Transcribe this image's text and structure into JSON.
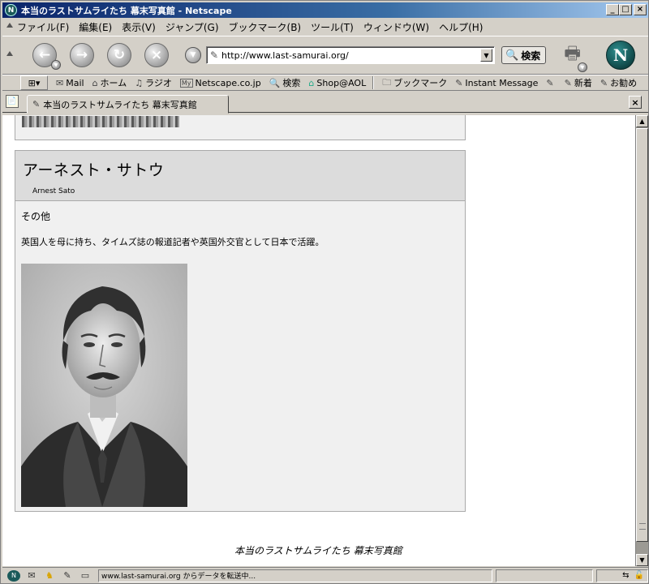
{
  "window": {
    "title": "本当のラストサムライたち 幕末写真館 - Netscape",
    "app_icon": "N",
    "minimize_glyph": "_",
    "maximize_glyph": "□",
    "close_glyph": "×"
  },
  "menubar": {
    "items": [
      "ファイル(F)",
      "編集(E)",
      "表示(V)",
      "ジャンプ(G)",
      "ブックマーク(B)",
      "ツール(T)",
      "ウィンドウ(W)",
      "ヘルプ(H)"
    ]
  },
  "navbar": {
    "back_glyph": "←",
    "forward_glyph": "→",
    "reload_glyph": "↻",
    "stop_glyph": "×",
    "url": "http://www.last-samurai.org/",
    "search_label": "検索",
    "logo": "N"
  },
  "personalbar": {
    "items": [
      {
        "icon": "mail-icon",
        "label": "Mail"
      },
      {
        "icon": "home-icon",
        "label": "ホーム"
      },
      {
        "icon": "headphones-icon",
        "label": "ラジオ"
      },
      {
        "icon": "my-icon",
        "label": "Netscape.co.jp"
      },
      {
        "icon": "search-icon",
        "label": "検索"
      },
      {
        "icon": "shop-icon",
        "label": "Shop@AOL"
      },
      {
        "icon": "folder-icon",
        "label": "ブックマーク"
      },
      {
        "icon": "bookmark-icon",
        "label": "Instant Message"
      },
      {
        "icon": "bookmark-icon",
        "label": ""
      },
      {
        "icon": "bookmark-icon",
        "label": "新着"
      },
      {
        "icon": "bookmark-icon",
        "label": "お勧め"
      }
    ]
  },
  "tab": {
    "label": "本当のラストサムライたち 幕末写真館"
  },
  "page": {
    "person": {
      "name_jp": "アーネスト・サトウ",
      "name_en": "Arnest Sato",
      "category": "その他",
      "description": "英国人を母に持ち、タイムズ誌の報道記者や英国外交官として日本で活躍。"
    },
    "footer_title": "本当のラストサムライたち 幕末写真館"
  },
  "status": {
    "text": "www.last-samurai.org からデータを転送中..."
  }
}
